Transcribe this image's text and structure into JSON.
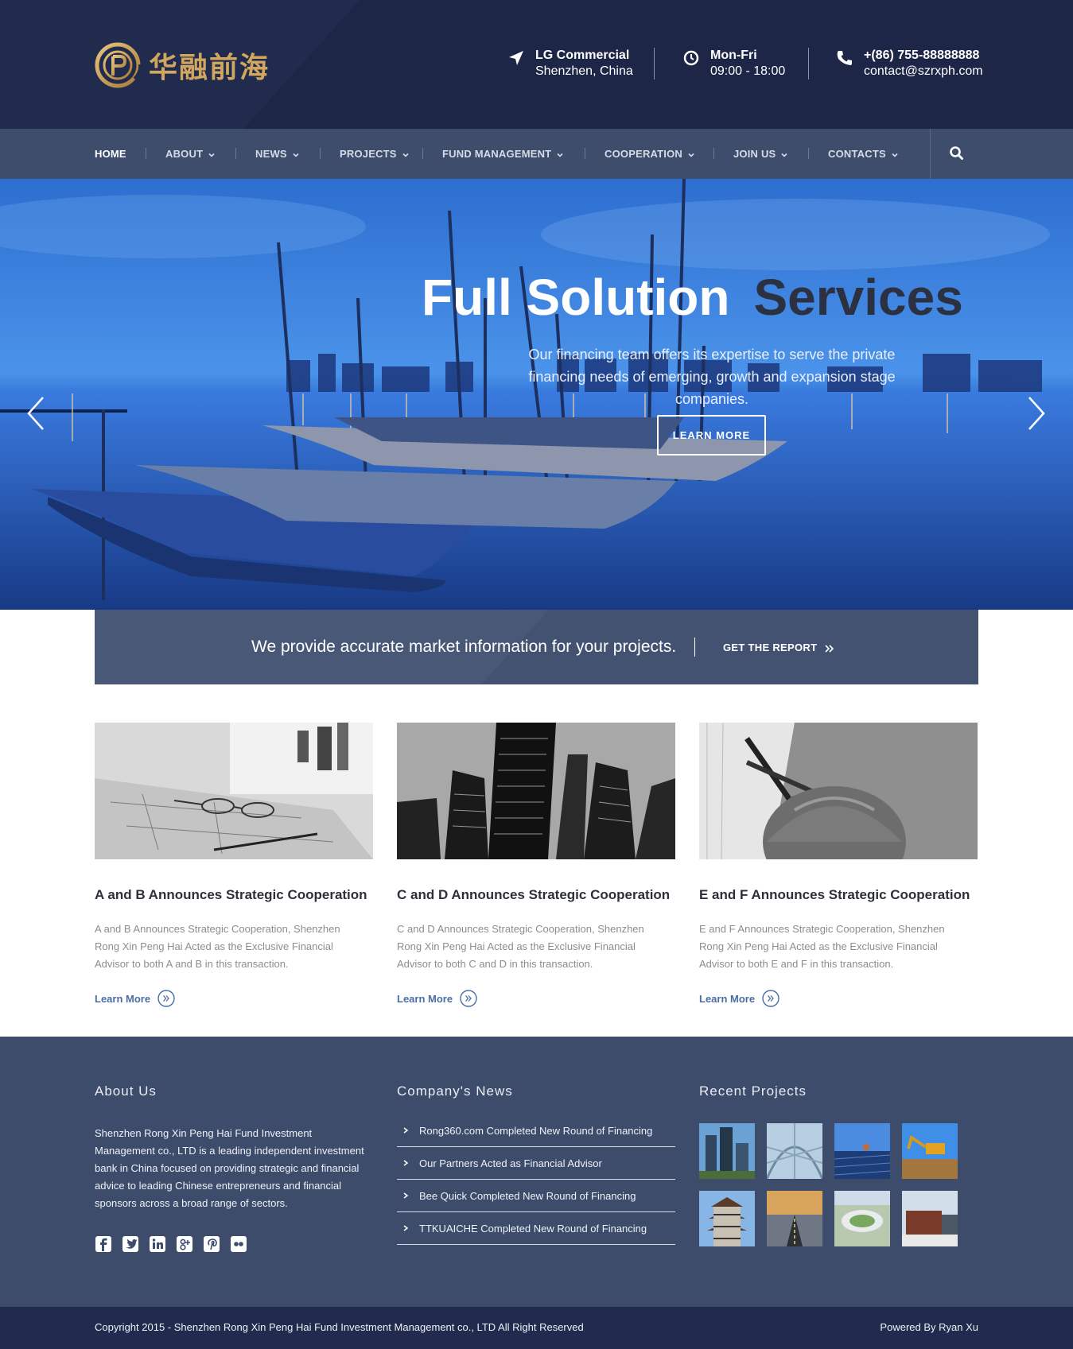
{
  "brand": {
    "logo_text": "华融前海",
    "gold": "#d1a760"
  },
  "header": {
    "location": {
      "line1": "LG Commercial",
      "line2": "Shenzhen, China",
      "icon": "location-arrow-icon"
    },
    "hours": {
      "line1": "Mon-Fri",
      "line2": "09:00 - 18:00",
      "icon": "clock-icon"
    },
    "contact": {
      "line1": "+(86) 755-88888888",
      "line2": "contact@szrxph.com",
      "icon": "phone-icon"
    },
    "colors": {
      "top": "#212b4d",
      "nav": "#3e4d6b"
    }
  },
  "nav": {
    "items": [
      {
        "label": "HOME",
        "active": true,
        "dropdown": false
      },
      {
        "label": "ABOUT",
        "dropdown": true
      },
      {
        "label": "NEWS",
        "dropdown": true
      },
      {
        "label": "PROJECTS",
        "dropdown": true
      },
      {
        "label": "FUND MANAGEMENT",
        "dropdown": true
      },
      {
        "label": "COOPERATION",
        "dropdown": true
      },
      {
        "label": "JOIN US",
        "dropdown": true
      },
      {
        "label": "CONTACTS",
        "dropdown": true
      }
    ],
    "search_icon": "search-icon"
  },
  "hero": {
    "title_white": "Full Solution",
    "title_dark": "Services",
    "text": "Our financing team offers its expertise to serve the private financing needs of emerging, growth and expansion stage companies.",
    "button": "LEARN MORE"
  },
  "cta": {
    "text": "We provide accurate market information for your projects.",
    "link": "GET THE REPORT",
    "link_icon": "double-chevron-right-icon"
  },
  "cards": [
    {
      "title": "A and B Announces Strategic Cooperation",
      "desc": "A and B Announces Strategic Cooperation, Shenzhen Rong Xin Peng Hai Acted as the Exclusive Financial Advisor to both A and B in this transaction.",
      "more": "Learn More"
    },
    {
      "title": "C and D Announces Strategic Cooperation",
      "desc": "C and D Announces Strategic Cooperation, Shenzhen Rong Xin Peng Hai Acted as the Exclusive Financial Advisor to both C and D in this transaction.",
      "more": "Learn More"
    },
    {
      "title": "E and F Announces Strategic Cooperation",
      "desc": "E and F Announces Strategic Cooperation, Shenzhen Rong Xin Peng Hai Acted as the Exclusive Financial Advisor to both E and F in this transaction.",
      "more": "Learn More"
    }
  ],
  "footer": {
    "about": {
      "heading": "About Us",
      "text": "Shenzhen Rong Xin Peng Hai Fund Investment Management co., LTD is a leading independent investment bank in China focused on providing strategic and financial advice to leading Chinese entrepreneurs and financial sponsors across a broad range of sectors.",
      "socials": [
        "facebook-icon",
        "twitter-icon",
        "linkedin-icon",
        "google-plus-icon",
        "pinterest-icon",
        "flickr-icon"
      ]
    },
    "news": {
      "heading": "Company's News",
      "items": [
        "Rong360.com Completed New Round of Financing",
        "Our Partners Acted as Financial Advisor",
        "Bee Quick Completed New Round of Financing",
        "TTKUAICHE Completed New Round of Financing"
      ]
    },
    "projects": {
      "heading": "Recent Projects"
    },
    "copyright": "Copyright 2015 - Shenzhen Rong Xin Peng Hai Fund Investment Management co., LTD All Right Reserved",
    "powered": "Powered By Ryan Xu"
  }
}
